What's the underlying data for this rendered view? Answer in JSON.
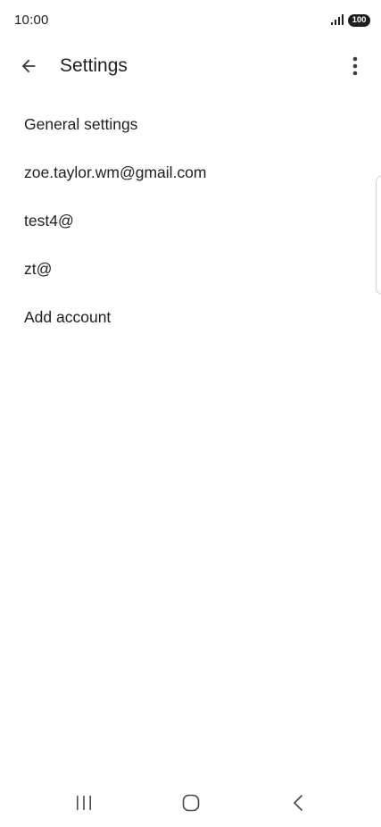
{
  "status_bar": {
    "time": "10:00",
    "battery": "100"
  },
  "app_bar": {
    "title": "Settings"
  },
  "settings": {
    "items": [
      {
        "label": "General settings"
      },
      {
        "label": "zoe.taylor.wm@gmail.com"
      },
      {
        "label": "test4@"
      },
      {
        "label": "zt@"
      },
      {
        "label": "Add account"
      }
    ]
  },
  "icons": {
    "back": "arrow-back-icon",
    "more": "more-vert-icon",
    "signal": "signal-icon",
    "nav_recents": "recents-icon",
    "nav_home": "home-icon",
    "nav_back": "nav-back-icon"
  },
  "colors": {
    "text": "#1f1f1f",
    "background": "#ffffff"
  }
}
